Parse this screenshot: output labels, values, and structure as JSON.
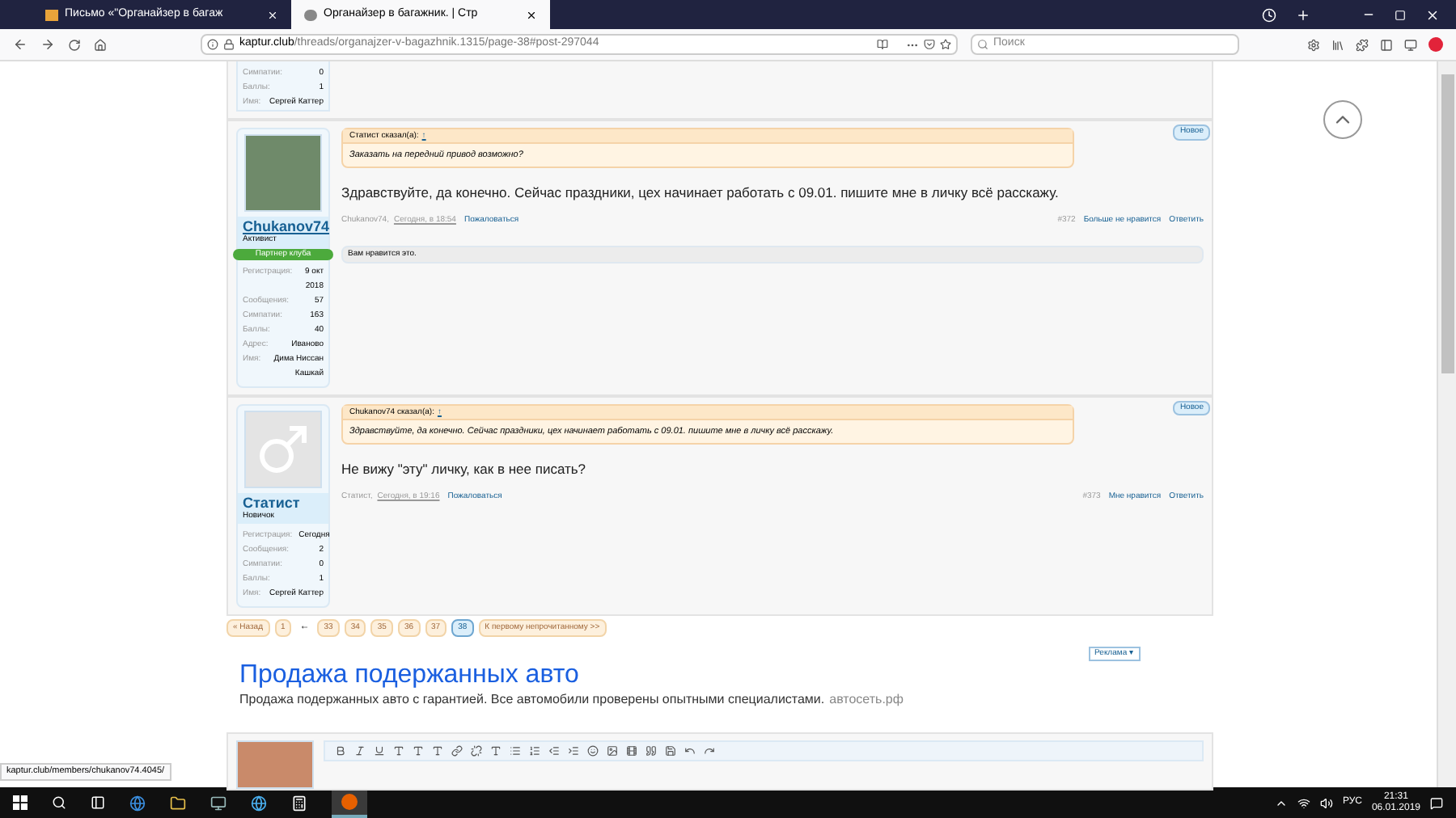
{
  "browser": {
    "tabs": [
      {
        "title": "Письмо «\"Органайзер в багаж",
        "selected": false
      },
      {
        "title": "Органайзер в багажник. | Стр",
        "selected": true
      }
    ],
    "url_host": "kaptur.club",
    "url_path": "/threads/organajzer-v-bagazhnik.1315/page-38#post-297044",
    "search": {
      "placeholder": "Поиск"
    }
  },
  "first_post_tail": {
    "stats": [
      {
        "label": "Симпатии:",
        "value": "0"
      },
      {
        "label": "Баллы:",
        "value": "1"
      },
      {
        "label": "Имя:",
        "value": "Сергей Каттер"
      }
    ]
  },
  "posts": [
    {
      "user": {
        "name": "Chukanov74",
        "title": "Активист",
        "banner": "Партнер клуба",
        "avatar": {
          "kind": "photo"
        },
        "stats": [
          {
            "label": "Регистрация:",
            "value": "9 окт 2018"
          },
          {
            "label": "Сообщения:",
            "value": "57"
          },
          {
            "label": "Симпатии:",
            "value": "163"
          },
          {
            "label": "Баллы:",
            "value": "40"
          },
          {
            "label": "Адрес:",
            "value": "Иваново"
          },
          {
            "label": "Имя:",
            "value": "Дима Ниссан Кашкай"
          }
        ]
      },
      "badge": "Новое",
      "quote": {
        "author": "Статист сказал(а):",
        "arrow": "↑",
        "text": "Заказать на передний привод возможно?"
      },
      "text": "Здравствуйте, да конечно. Сейчас праздники, цех начинает работать с 09.01. пишите мне в личку всё расскажу.",
      "author": "Chukanov74,",
      "time": "Сегодня, в 18:54",
      "report": "Пожаловаться",
      "number": "#372",
      "like": "Больше не нравится",
      "reply": "Ответить",
      "liked_by": "Вам нравится это."
    },
    {
      "user": {
        "name": "Статист",
        "title": "Новичок",
        "avatar": {
          "kind": "default"
        },
        "stats": [
          {
            "label": "Регистрация:",
            "value": "Сегодня"
          },
          {
            "label": "Сообщения:",
            "value": "2"
          },
          {
            "label": "Симпатии:",
            "value": "0"
          },
          {
            "label": "Баллы:",
            "value": "1"
          },
          {
            "label": "Имя:",
            "value": "Сергей Каттер"
          }
        ]
      },
      "badge": "Новое",
      "quote": {
        "author": "Chukanov74 сказал(а):",
        "arrow": "↑",
        "text": "Здравствуйте, да конечно. Сейчас праздники, цех начинает работать с 09.01. пишите мне в личку всё расскажу."
      },
      "text": "Не вижу \"эту\" личку, как в нее писать?",
      "author": "Статист,",
      "time": "Сегодня, в 19:16",
      "report": "Пожаловаться",
      "number": "#373",
      "like": "Мне нравится",
      "reply": "Ответить"
    }
  ],
  "pagination": {
    "prev": "« Назад",
    "first": "1",
    "gap": "←",
    "pages": [
      {
        "label": "33",
        "selected": false
      },
      {
        "label": "34",
        "selected": false
      },
      {
        "label": "35",
        "selected": false
      },
      {
        "label": "36",
        "selected": false
      },
      {
        "label": "37",
        "selected": false
      },
      {
        "label": "38",
        "selected": true
      }
    ],
    "unread": "К первому непрочитанному >>"
  },
  "ad": {
    "label": "Реклама ▾",
    "title": "Продажа подержанных авто",
    "text": "Продажа подержанных авто с гарантией. Все автомобили проверены опытными специалистами.",
    "domain": "автосеть.рф"
  },
  "status_url": "kaptur.club/members/chukanov74.4045/",
  "taskbar": {
    "language": "РУС",
    "time": "21:31",
    "date": "06.01.2019"
  }
}
